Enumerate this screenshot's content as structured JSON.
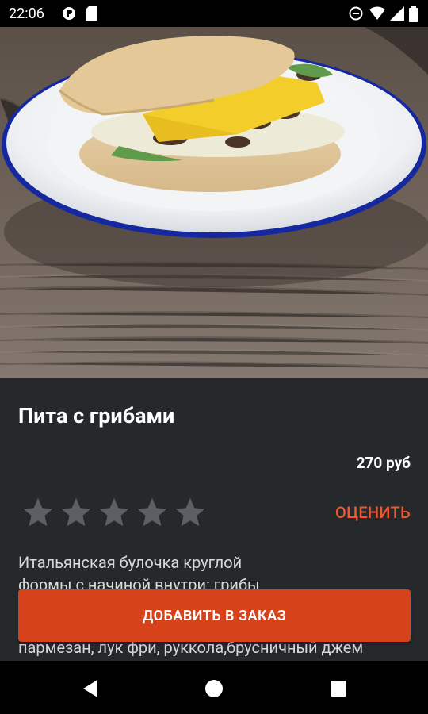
{
  "status_bar": {
    "time": "22:06",
    "icons": [
      "app-notification-icon",
      "sd-card-icon",
      "do-not-disturb-icon",
      "wifi-icon",
      "signal-icon",
      "battery-icon"
    ]
  },
  "product": {
    "title": "Пита с грибами",
    "price": "270 руб",
    "rating": {
      "stars_total": 5,
      "stars_filled": 0,
      "action_label": "ОЦЕНИТЬ"
    },
    "description_line1": "Итальянская булочка круглой",
    "description_line2": "формы с начиной внутри: грибы",
    "description_tail": "пармезан, лук фри, руккола,брусничный джем",
    "image_desc": "pita sandwich with mushrooms, cheese and greens on a white enamel plate"
  },
  "actions": {
    "add_to_order": "ДОБАВИТЬ В ЗАКАЗ"
  },
  "navbar": {
    "back": "back-icon",
    "home": "home-icon",
    "recents": "recents-icon"
  },
  "colors": {
    "accent": "#d6431b",
    "accent_text": "#ef5a2c",
    "background": "#26292c",
    "star": "#5c5f63"
  }
}
